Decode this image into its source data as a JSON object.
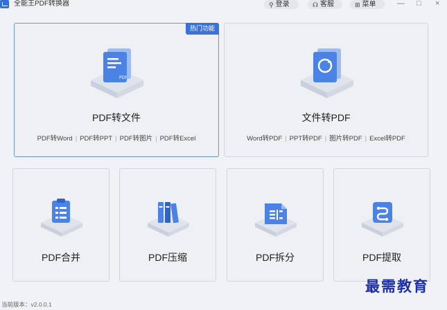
{
  "window": {
    "title": "全能王PDF转换器",
    "login_label": "登录",
    "service_label": "客服",
    "menu_label": "菜单",
    "min_glyph": "—",
    "max_glyph": "□",
    "close_glyph": "×"
  },
  "cards": {
    "pdf_to_file": {
      "title": "PDF转文件",
      "badge": "热门功能",
      "subs": [
        "PDF转Word",
        "PDF转PPT",
        "PDF转图片",
        "PDF转Excel"
      ],
      "separator": "|"
    },
    "file_to_pdf": {
      "title": "文件转PDF",
      "subs": [
        "Word转PDF",
        "PPT转PDF",
        "图片转PDF",
        "Excel转PDF"
      ],
      "separator": "|"
    },
    "merge": {
      "title": "PDF合并"
    },
    "compress": {
      "title": "PDF压缩"
    },
    "split": {
      "title": "PDF拆分"
    },
    "extract": {
      "title": "PDF提取"
    }
  },
  "footer": {
    "version": "当前版本：v2.0.0.1"
  },
  "watermark": "最需教育",
  "colors": {
    "accent": "#3a72d9",
    "icon_blue": "#4a82e6",
    "background": "#f1f2f5"
  }
}
